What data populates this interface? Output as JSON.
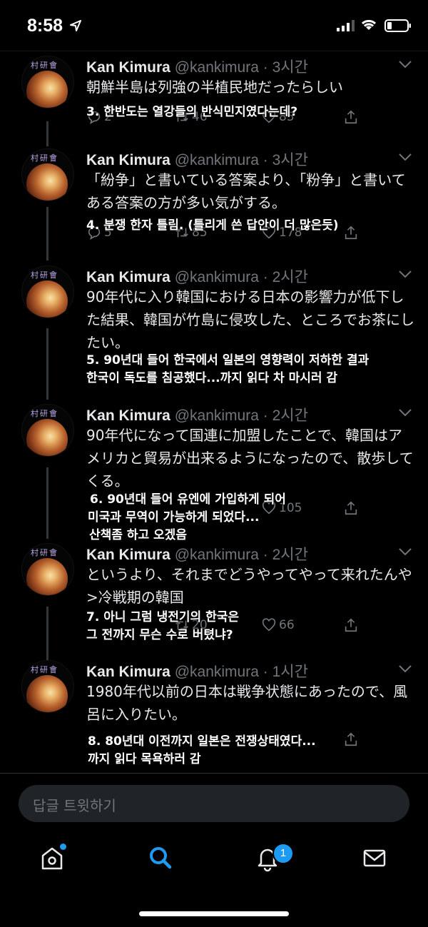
{
  "status": {
    "time": "8:58"
  },
  "author": {
    "name": "Kan Kimura",
    "handle": "@kankimura",
    "avatar_kanji": "村研會"
  },
  "tweets": [
    {
      "time": "3시간",
      "text": "朝鮮半島は列強の半植民地だったらしい",
      "caption1": "3. 한반도는 열강들의 반식민지였다는데?",
      "caption2": "",
      "caption3": "",
      "replies": "2",
      "retweets": "46",
      "likes": "85"
    },
    {
      "time": "3시간",
      "text": "「紛争」と書いている答案より、「粉争」と書いてある答案の方が多い気がする。",
      "caption1": "4. 분쟁 한자 틀림. (틀리게 쓴 답안이 더 많은듯)",
      "caption2": "",
      "caption3": "",
      "replies": "5",
      "retweets": "85",
      "likes": "178"
    },
    {
      "time": "2시간",
      "text": "90年代に入り韓国における日本の影響力が低下した結果、韓国が竹島に侵攻した、ところでお茶にしたい。",
      "caption1": "5. 90년대 들어 한국에서 일본의 영향력이 저하한 결과",
      "caption2": "한국이 독도를 침공했다...까지 읽다 차 마시러 감",
      "caption3": "",
      "replies": "",
      "retweets": "",
      "likes": ""
    },
    {
      "time": "2시간",
      "text": "90年代になって国連に加盟したことで、韓国はアメリカと貿易が出来るようになったので、散歩してくる。",
      "caption1": "6. 90년대 들어 유엔에 가입하게 되어",
      "caption2": "미국과 무역이 가능하게 되었다...",
      "caption3": "산책좀 하고 오겠음",
      "replies": "",
      "retweets": "",
      "likes": "105"
    },
    {
      "time": "2시간",
      "text": "というより、それまでどうやってやって来れたんや>冷戦期の韓国",
      "caption1": "7. 아니 그럼 냉전기의 한국은",
      "caption2": "그 전까지 무슨 수로 버텼냐?",
      "caption3": "",
      "replies": "",
      "retweets": "20",
      "likes": "66"
    },
    {
      "time": "1시간",
      "text": "1980年代以前の日本は戦争状態にあったので、風呂に入りたい。",
      "caption1": "8. 80년대 이전까지 일본은 전쟁상태였다...",
      "caption2": "까지 읽다 목욕하러 감",
      "caption3": "",
      "replies": "",
      "retweets": "",
      "likes": ""
    }
  ],
  "reply_bar": {
    "placeholder": "답글 트윗하기"
  },
  "tabs": {
    "notifications_badge": "1"
  },
  "colors": {
    "accent": "#1d9bf0",
    "background": "#000000",
    "muted": "#71767b"
  }
}
